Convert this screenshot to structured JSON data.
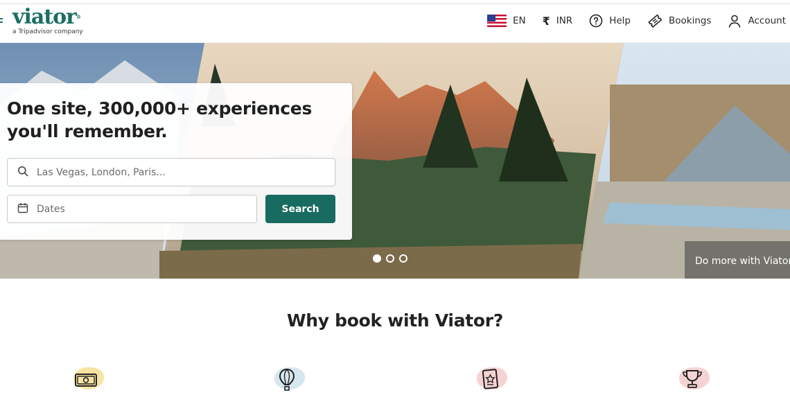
{
  "header": {
    "logo_text": "viator",
    "logo_mark": "®",
    "logo_tagline": "a Tripadvisor company",
    "nav": {
      "language": "EN",
      "currency": "INR",
      "help": "Help",
      "bookings": "Bookings",
      "account": "Account"
    }
  },
  "hero": {
    "headline": "One site, 300,000+ experiences you'll remember.",
    "search": {
      "location_placeholder": "Las Vegas, London, Paris...",
      "dates_placeholder": "Dates",
      "button_label": "Search"
    },
    "carousel": {
      "slides": 3,
      "active_index": 0
    },
    "promo_text": "Do more with Viator"
  },
  "why": {
    "title": "Why book with Viator?",
    "icons": [
      "money-icon",
      "hot-air-balloon-icon",
      "badge-star-icon",
      "trophy-icon"
    ]
  },
  "colors": {
    "brand": "#186b60",
    "blob_yellow": "#f7e4a3",
    "blob_blue": "#d6e6ee",
    "blob_pink": "#f6d3d3"
  }
}
